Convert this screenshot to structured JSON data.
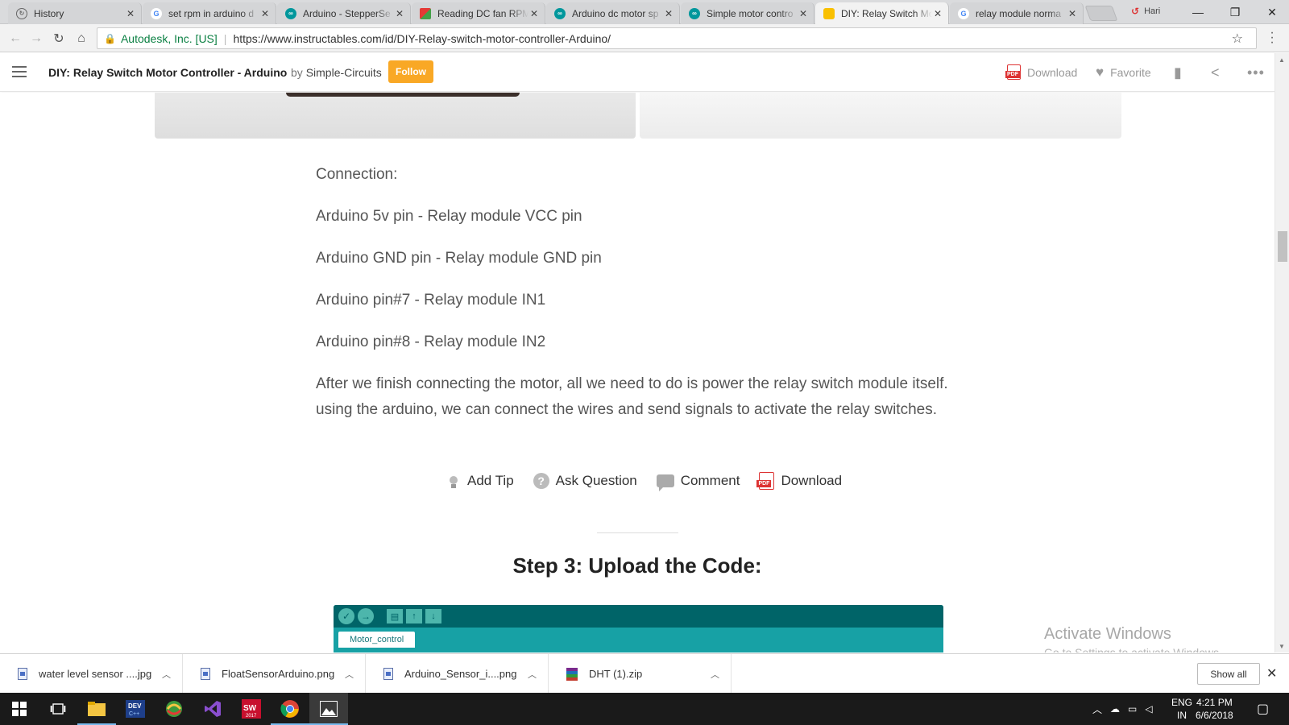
{
  "browser": {
    "tabs": [
      {
        "title": "History",
        "favicon": "history-icon",
        "active": false
      },
      {
        "title": "set rpm in arduino d",
        "favicon": "google-icon",
        "active": false
      },
      {
        "title": "Arduino - StepperSe",
        "favicon": "arduino-icon",
        "active": false
      },
      {
        "title": "Reading DC fan RPM",
        "favicon": "site-icon",
        "active": false
      },
      {
        "title": "Arduino dc motor sp",
        "favicon": "arduino-icon",
        "active": false
      },
      {
        "title": "Simple motor contro",
        "favicon": "arduino-icon",
        "active": false
      },
      {
        "title": "DIY: Relay Switch Mo",
        "favicon": "instructables-icon",
        "active": true
      },
      {
        "title": "relay module norma",
        "favicon": "google-icon",
        "active": false
      }
    ],
    "profile_name": "Hari",
    "address": {
      "org": "Autodesk, Inc. [US]",
      "url": "https://www.instructables.com/id/DIY-Relay-switch-motor-controller-Arduino/"
    }
  },
  "site_header": {
    "title": "DIY: Relay Switch Motor Controller - Arduino",
    "by": "by",
    "author": "Simple-Circuits",
    "follow_label": "Follow",
    "download_label": "Download",
    "favorite_label": "Favorite"
  },
  "article": {
    "paragraphs": [
      "Connection:",
      "Arduino 5v pin - Relay module VCC pin",
      "Arduino GND pin - Relay module GND pin",
      "Arduino pin#7 - Relay module IN1",
      "Arduino pin#8 - Relay module IN2",
      "After we finish connecting the motor, all we need to do is power the relay switch module itself. using the arduino, we can connect the wires and send signals to activate the relay switches."
    ],
    "actions": {
      "add_tip": "Add Tip",
      "ask_question": "Ask Question",
      "comment": "Comment",
      "download": "Download"
    },
    "step_heading": "Step 3: Upload the Code:",
    "ide_tab": "Motor_control"
  },
  "watermark": {
    "line1": "Activate Windows",
    "line2": "Go to Settings to activate Windows."
  },
  "downloads": {
    "items": [
      {
        "name": "water level sensor ....jpg",
        "type": "image"
      },
      {
        "name": "FloatSensorArduino.png",
        "type": "image"
      },
      {
        "name": "Arduino_Sensor_i....png",
        "type": "image"
      },
      {
        "name": "DHT (1).zip",
        "type": "zip"
      }
    ],
    "show_all": "Show all"
  },
  "taskbar": {
    "lang": "ENG",
    "region": "IN",
    "time": "4:21 PM",
    "date": "6/6/2018"
  },
  "colors": {
    "follow": "#f9a825",
    "secure": "#0b8043",
    "ide_dark": "#006468",
    "ide_teal": "#17a1a5",
    "taskbar": "#1a1a1a"
  }
}
